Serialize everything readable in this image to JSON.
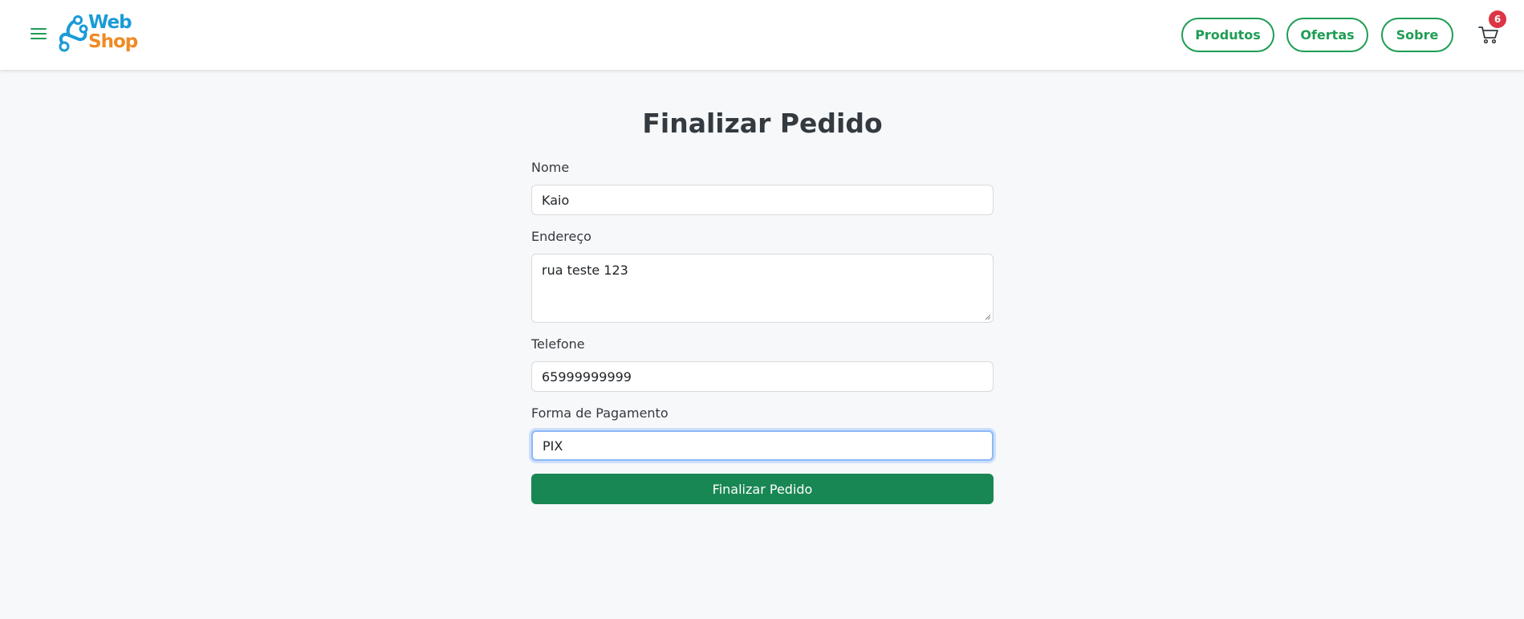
{
  "header": {
    "logo_top": "Web",
    "logo_bottom": "Shop",
    "nav": [
      {
        "label": "Produtos"
      },
      {
        "label": "Ofertas"
      },
      {
        "label": "Sobre"
      }
    ],
    "cart_count": "6"
  },
  "form": {
    "title": "Finalizar Pedido",
    "name_label": "Nome",
    "name_value": "Kaio",
    "address_label": "Endereço",
    "address_value": "rua teste 123",
    "phone_label": "Telefone",
    "phone_value": "65999999999",
    "payment_label": "Forma de Pagamento",
    "payment_value": "PIX",
    "submit_label": "Finalizar Pedido"
  },
  "colors": {
    "primary_green": "#198754",
    "nav_green": "#1f9d55",
    "logo_blue": "#1a9bd7",
    "logo_orange": "#f08a24",
    "badge_red": "#dc3545",
    "focus_blue": "#8bb8f7"
  },
  "icons": {
    "menu": "hamburger-icon",
    "logo": "network-nodes-icon",
    "cart": "shopping-cart-icon"
  }
}
